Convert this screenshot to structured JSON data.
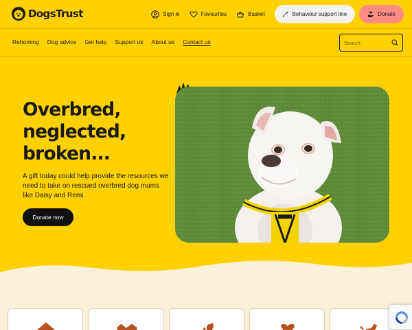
{
  "brand": {
    "name": "DogsTrust",
    "logo_icon": "dog-head-logo-icon"
  },
  "topbar": {
    "sign_in": "Sign in",
    "favourites": "Favourites",
    "basket": "Basket",
    "behaviour_support": "Behaviour support line",
    "donate": "Donate"
  },
  "nav": {
    "items": [
      "Rehoming",
      "Dog advice",
      "Get help",
      "Support us",
      "About us",
      "Contact us"
    ],
    "active": "Contact us"
  },
  "search": {
    "placeholder": "Search"
  },
  "hero": {
    "headline_lines": [
      "Overbred,",
      "neglected,",
      "broken..."
    ],
    "subtext": "A gift today could help provide the resources we need to take on rescued overbred dog mums like Daisy and Remi.",
    "cta": "Donate now",
    "image_alt": "white-dog-photo"
  },
  "colors": {
    "brand_yellow": "#ffd100",
    "donate_pink": "#fe8b84",
    "cream": "#fbf1d8",
    "card_icon": "#b7521f"
  },
  "cards": [
    {
      "icon": "house-icon"
    },
    {
      "icon": "dog-face-icon"
    },
    {
      "icon": "dog-sitting-icon"
    },
    {
      "icon": "heart-icon"
    },
    {
      "icon": "dog-running-icon"
    }
  ]
}
